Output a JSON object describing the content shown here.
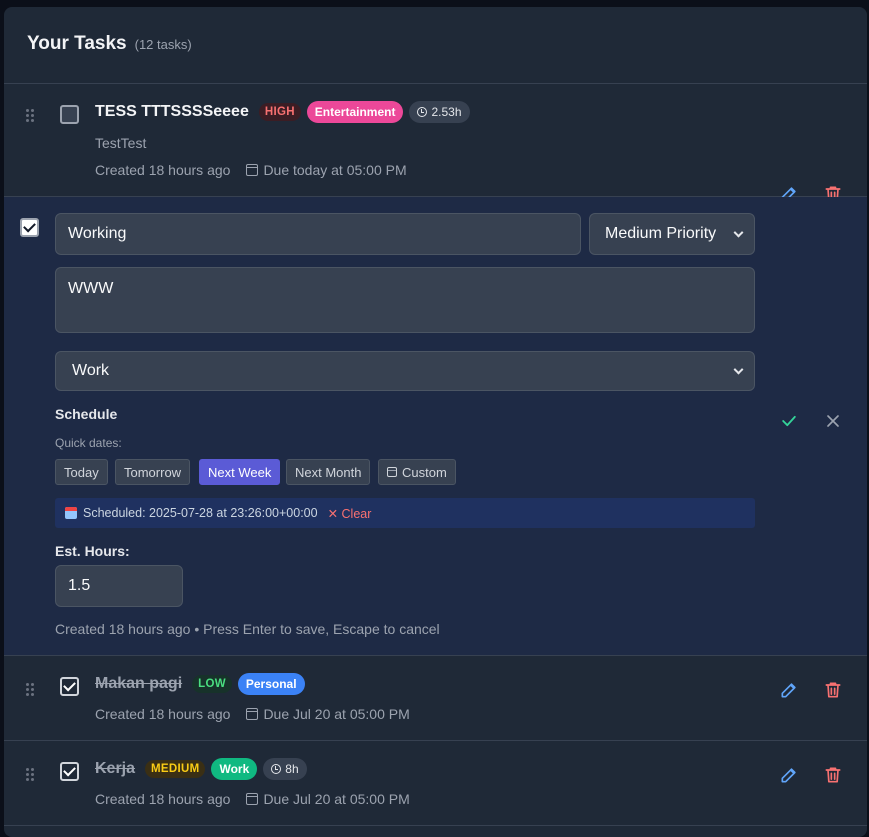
{
  "header": {
    "title": "Your Tasks",
    "count": "(12 tasks)"
  },
  "tasks": [
    {
      "title": "TESS TTTSSSSeeee",
      "priority": "HIGH",
      "category": "Entertainment",
      "category_color": "#ec4899",
      "hours": "2.53h",
      "description": "TestTest",
      "created": "Created 18 hours ago",
      "due": "Due today at 05:00 PM",
      "completed": false
    },
    {
      "title": "Makan pagi",
      "priority": "LOW",
      "category": "Personal",
      "category_color": "#3b82f6",
      "created": "Created 18 hours ago",
      "due": "Due Jul 20 at 05:00 PM",
      "completed": true
    },
    {
      "title": "Kerja",
      "priority": "MEDIUM",
      "category": "Work",
      "category_color": "#10b981",
      "hours": "8h",
      "created": "Created 18 hours ago",
      "due": "Due Jul 20 at 05:00 PM",
      "completed": true
    }
  ],
  "edit": {
    "title_value": "Working",
    "priority_value": "Medium Priority",
    "description_value": "WWW",
    "category_value": "Work",
    "schedule_label": "Schedule",
    "quick_dates_label": "Quick dates:",
    "quick_dates": [
      "Today",
      "Tomorrow",
      "Next Week",
      "Next Month",
      "Custom"
    ],
    "active_quick_date": "Next Week",
    "scheduled_text": "Scheduled: 2025-07-28 at 23:26:00+00:00",
    "clear_label": "Clear",
    "hours_label": "Est. Hours:",
    "hours_value": "1.5",
    "hint": "Created 18 hours ago • Press Enter to save, Escape to cancel"
  },
  "colors": {
    "accent": "#5b5bd6",
    "edit_icon": "#60a5fa",
    "delete_icon": "#f87171",
    "save_icon": "#34d399"
  }
}
